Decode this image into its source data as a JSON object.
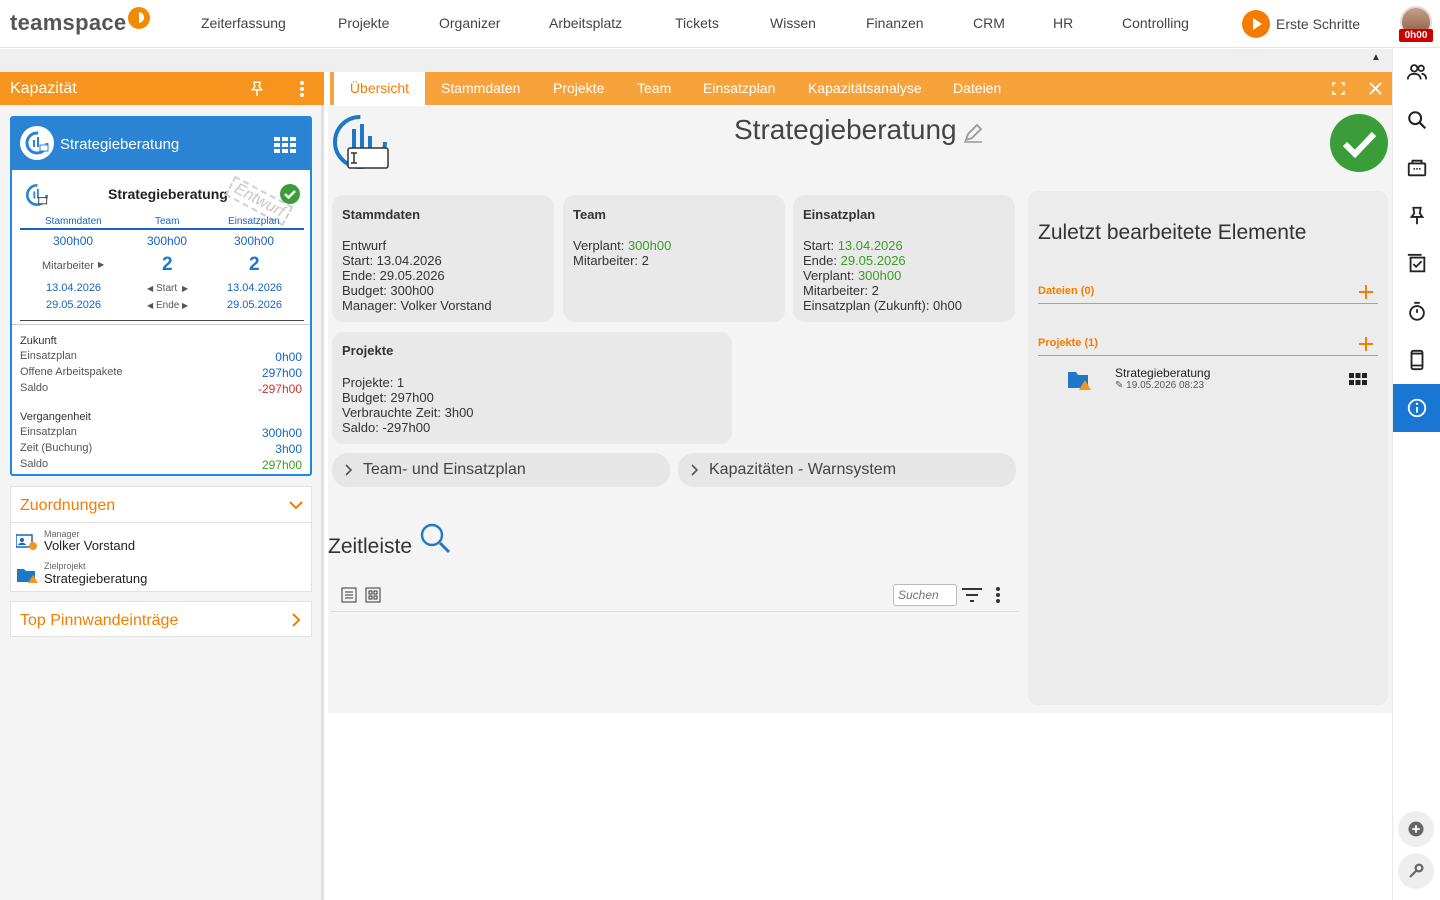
{
  "app": {
    "logo_text": "teamspace"
  },
  "nav": {
    "items": [
      "Zeiterfassung",
      "Projekte",
      "Organizer",
      "Arbeitsplatz",
      "Tickets",
      "Wissen",
      "Finanzen",
      "CRM",
      "HR",
      "Controlling"
    ],
    "start_label": "Erste Schritte",
    "user_time": "0h00"
  },
  "left_panel": {
    "title": "Kapazität",
    "card": {
      "name": "Strategieberatung",
      "sub_name": "Strategieberatung",
      "stamp": "Entwurf",
      "cols": [
        "Stammdaten",
        "Team",
        "Einsatzplan"
      ],
      "hours": [
        "300h00",
        "300h00",
        "300h00"
      ],
      "mitarbeiter_label": "Mitarbeiter",
      "mitarbeiter_values": [
        "2",
        "2"
      ],
      "start_label": "Start",
      "end_label": "Ende",
      "start_dates": [
        "13.04.2026",
        "13.04.2026"
      ],
      "end_dates": [
        "29.05.2026",
        "29.05.2026"
      ],
      "future_title": "Zukunft",
      "future": [
        {
          "label": "Einsatzplan",
          "value": "0h00"
        },
        {
          "label": "Offene Arbeitspakete",
          "value": "297h00"
        },
        {
          "label": "Saldo",
          "value": "-297h00"
        }
      ],
      "past_title": "Vergangenheit",
      "past": [
        {
          "label": "Einsatzplan",
          "value": "300h00"
        },
        {
          "label": "Zeit (Buchung)",
          "value": "3h00"
        },
        {
          "label": "Saldo",
          "value": "297h00"
        }
      ]
    },
    "assign": {
      "title": "Zuordnungen",
      "manager_label": "Manager",
      "manager": "Volker Vorstand",
      "target_label": "Zielprojekt",
      "target": "Strategieberatung"
    },
    "pinboard_title": "Top Pinnwandeinträge"
  },
  "tabs": [
    "Übersicht",
    "Stammdaten",
    "Projekte",
    "Team",
    "Einsatzplan",
    "Kapazitätsanalyse",
    "Dateien"
  ],
  "main": {
    "title": "Strategieberatung",
    "stammdaten": {
      "title": "Stammdaten",
      "status": "Entwurf",
      "start": "Start: 13.04.2026",
      "end": "Ende: 29.05.2026",
      "budget": "Budget: 300h00",
      "manager": "Manager: Volker Vorstand"
    },
    "team": {
      "title": "Team",
      "verplant_label": "Verplant: ",
      "verplant_value": "300h00",
      "mitarbeiter": "Mitarbeiter: 2"
    },
    "einsatzplan": {
      "title": "Einsatzplan",
      "start_label": "Start: ",
      "start_value": "13.04.2026",
      "end_label": "Ende: ",
      "end_value": "29.05.2026",
      "verplant_label": "Verplant: ",
      "verplant_value": "300h00",
      "mitarbeiter": "Mitarbeiter: 2",
      "future": "Einsatzplan (Zukunft): 0h00"
    },
    "projekte": {
      "title": "Projekte",
      "count": "Projekte: 1",
      "budget": "Budget: 297h00",
      "used": "Verbrauchte Zeit: 3h00",
      "saldo": "Saldo: -297h00"
    },
    "collapsible1": "Team- und Einsatzplan",
    "collapsible2": "Kapazitäten - Warnsystem",
    "timeline_title": "Zeitleiste",
    "search_placeholder": "Suchen"
  },
  "recent": {
    "title": "Zuletzt bearbeitete Elemente",
    "files_label": "Dateien (0)",
    "projects_label": "Projekte (1)",
    "item_name": "Strategieberatung",
    "item_date": "19.05.2026 08:23"
  },
  "colors": {
    "orange": "#f7941d",
    "blue": "#1e88e5",
    "green": "#3a9d23",
    "red": "#d32f2f"
  }
}
